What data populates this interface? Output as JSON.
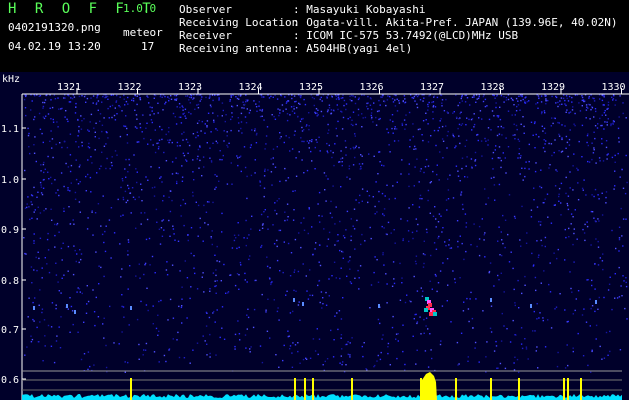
{
  "app": {
    "title": "H R O F F T",
    "version": "1.0.0"
  },
  "file": {
    "name": "0402191320.png",
    "timestamp": "04.02.19 13:20"
  },
  "meteor": {
    "label": "meteor",
    "count": "17"
  },
  "info": [
    {
      "label": "Observer",
      "value": ": Masayuki Kobayashi"
    },
    {
      "label": "Receiving Location",
      "value": ": Ogata-vill. Akita-Pref. JAPAN (139.96E, 40.02N)"
    },
    {
      "label": "Receiver",
      "value": ": ICOM IC-575 53.7492(@LCD)MHz USB"
    },
    {
      "label": "Receiving antenna",
      "value": ": A504HB(yagi 4el)"
    }
  ],
  "spectrogram": {
    "y_unit": "kHz",
    "y_ticks": [
      "1.1",
      "1.0",
      "0.9",
      "0.8",
      "0.7",
      "0.6"
    ],
    "time_ticks": [
      "1321",
      "1322",
      "1323",
      "1324",
      "1325",
      "1326",
      "1327",
      "1328",
      "1329",
      "1330"
    ],
    "colors": {
      "noise": "#2a2aff",
      "background": "#00002a",
      "echo_hot": "#ff2a4a",
      "echo_mid": "#ff55ff",
      "echo_cool": "#00c8c8",
      "level_trace": "#00e0ff",
      "level_peak": "#ffff00"
    }
  }
}
